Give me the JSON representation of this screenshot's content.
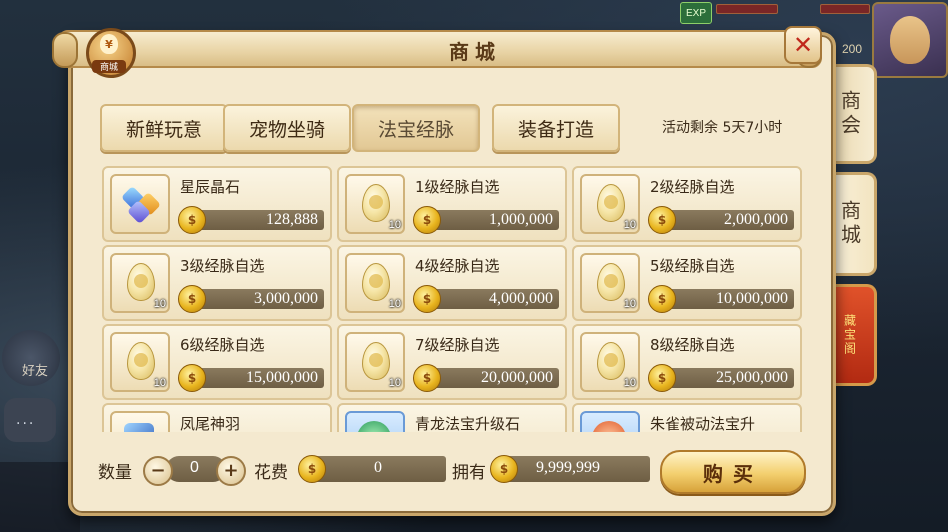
{
  "header": {
    "title": "商城",
    "badge_label": "商城",
    "badge_symbol": "¥"
  },
  "hud": {
    "exp_label": "EXP",
    "number": "200"
  },
  "side_tabs": [
    {
      "label": "商会"
    },
    {
      "label": "商城"
    },
    {
      "label": "藏宝阁"
    }
  ],
  "left_overlay": {
    "friend_label": "好友",
    "chat_dots": "···"
  },
  "category_tabs": [
    {
      "label": "新鲜玩意"
    },
    {
      "label": "宠物坐骑"
    },
    {
      "label": "法宝经脉",
      "selected": true
    },
    {
      "label": "装备打造"
    }
  ],
  "event": {
    "text": "活动剩余 5天7小时"
  },
  "items": [
    {
      "name": "星辰晶石",
      "price": "128,888",
      "icon": "crystal-icon",
      "qty": ""
    },
    {
      "name": "1级经脉自选",
      "price": "1,000,000",
      "icon": "egg-icon",
      "qty": "10"
    },
    {
      "name": "2级经脉自选",
      "price": "2,000,000",
      "icon": "egg-icon",
      "qty": "10"
    },
    {
      "name": "3级经脉自选",
      "price": "3,000,000",
      "icon": "egg-icon",
      "qty": "10"
    },
    {
      "name": "4级经脉自选",
      "price": "4,000,000",
      "icon": "egg-icon",
      "qty": "10"
    },
    {
      "name": "5级经脉自选",
      "price": "10,000,000",
      "icon": "egg-icon",
      "qty": "10"
    },
    {
      "name": "6级经脉自选",
      "price": "15,000,000",
      "icon": "egg-icon",
      "qty": "10"
    },
    {
      "name": "7级经脉自选",
      "price": "20,000,000",
      "icon": "egg-icon",
      "qty": "10"
    },
    {
      "name": "8级经脉自选",
      "price": "25,000,000",
      "icon": "egg-icon",
      "qty": "10"
    },
    {
      "name": "凤尾神羽",
      "price": "",
      "icon": "feather-icon",
      "qty": ""
    },
    {
      "name": "青龙法宝升级石",
      "price": "",
      "icon": "green-stone-icon",
      "qty": ""
    },
    {
      "name": "朱雀被动法宝升",
      "price": "",
      "icon": "red-stone-icon",
      "qty": ""
    }
  ],
  "purchase": {
    "quantity_label": "数量",
    "quantity": "0",
    "minus": "−",
    "plus": "+",
    "cost_label": "花费",
    "cost": "0",
    "owned_label": "拥有",
    "owned": "9,999,999",
    "buy_label": "购买",
    "coin_symbol": "$"
  },
  "colors": {
    "panel_bg": "#f4e9cf",
    "panel_border": "#c9a66a",
    "price_bar": "#7a6a50",
    "close_x": "#c0281c",
    "treasure_tab": "#c8361a"
  }
}
